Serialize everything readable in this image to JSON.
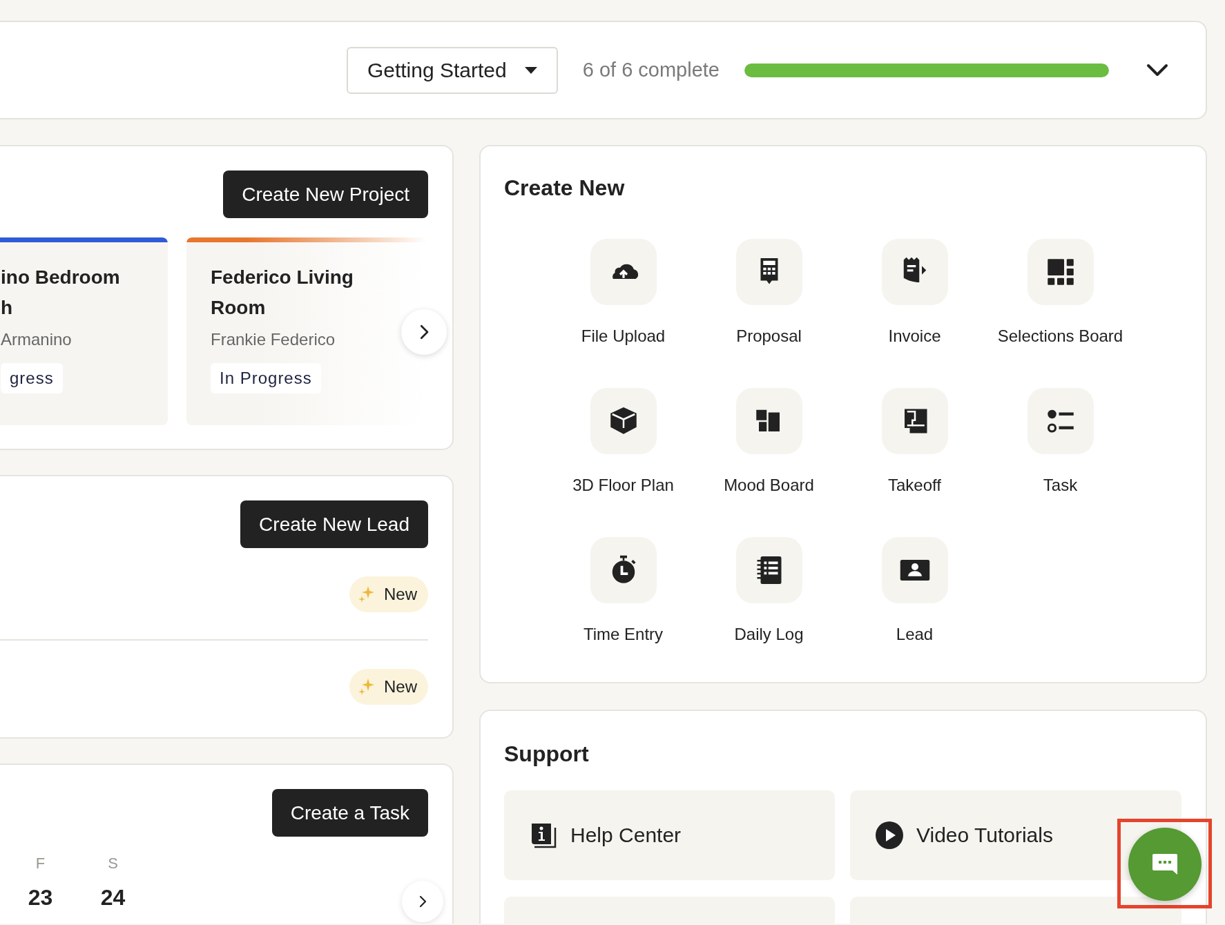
{
  "onboarding": {
    "checklist": "Getting Started",
    "progress_text": "6 of 6 complete",
    "level": 1
  },
  "projects": {
    "button": "Create New Project",
    "cards": [
      {
        "title": "ino Bedroom h",
        "client": "Armanino",
        "status": "gress",
        "color": "#2f5bd8"
      },
      {
        "title": "Federico Living Room",
        "client": "Frankie Federico",
        "status": "In Progress",
        "color": "#e8762d"
      }
    ]
  },
  "leads": {
    "button": "Create New Lead",
    "items": [
      {
        "badge": "New"
      },
      {
        "badge": "New"
      }
    ]
  },
  "tasks": {
    "button": "Create a Task",
    "days": [
      {
        "weekday": "F",
        "date": "23"
      },
      {
        "weekday": "S",
        "date": "24"
      }
    ]
  },
  "create_new": {
    "title": "Create New",
    "items": [
      {
        "label": "File Upload"
      },
      {
        "label": "Proposal"
      },
      {
        "label": "Invoice"
      },
      {
        "label": "Selections Board"
      },
      {
        "label": "3D Floor Plan"
      },
      {
        "label": "Mood Board"
      },
      {
        "label": "Takeoff"
      },
      {
        "label": "Task"
      },
      {
        "label": "Time Entry"
      },
      {
        "label": "Daily Log"
      },
      {
        "label": "Lead"
      }
    ]
  },
  "support": {
    "title": "Support",
    "items": [
      {
        "label": "Help Center"
      },
      {
        "label": "Video Tutorials"
      }
    ]
  }
}
